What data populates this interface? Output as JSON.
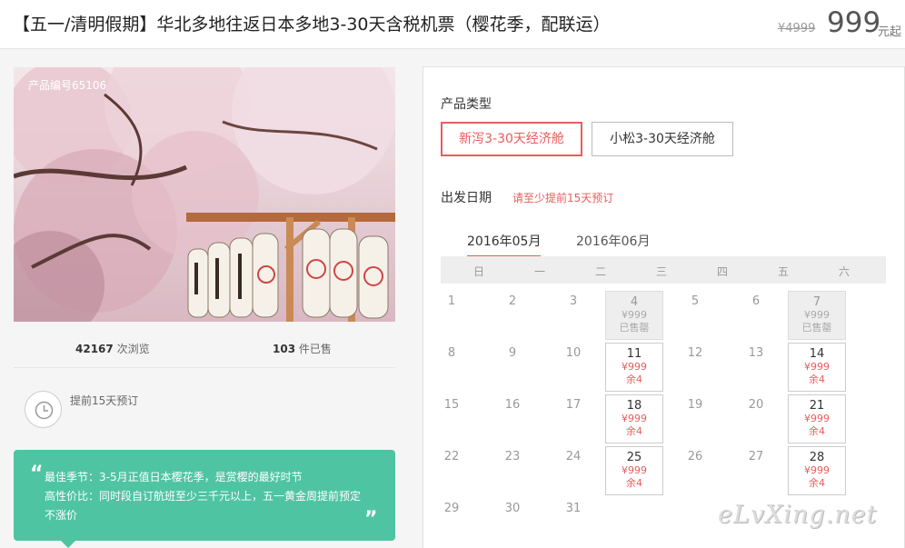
{
  "header": {
    "title": "【五一/清明假期】华北多地往返日本多地3-30天含税机票（樱花季，配联运）",
    "old_price": "¥4999",
    "price": "999",
    "price_unit": "元起"
  },
  "photo": {
    "product_code": "产品编号65106"
  },
  "stats": {
    "views_count": "42167",
    "views_label": "次浏览",
    "sold_count": "103",
    "sold_label": "件已售"
  },
  "advance": {
    "text": "提前15天预订",
    "icon": "clock-icon"
  },
  "tip": {
    "line1": "最佳季节：3-5月正值日本樱花季，是赏樱的最好时节",
    "line2": "高性价比：同时段自订航班至少三千元以上，五一黄金周提前预定",
    "line3": "不涨价",
    "open_quote": "“",
    "close_quote": "”"
  },
  "booking": {
    "type_label": "产品类型",
    "types": [
      "新泻3-30天经济舱",
      "小松3-30天经济舱"
    ],
    "selected_type": 0,
    "date_label": "出发日期",
    "date_hint": "请至少提前15天预订",
    "months": [
      "2016年05月",
      "2016年06月"
    ],
    "selected_month": 0,
    "weekdays": [
      "日",
      "一",
      "二",
      "三",
      "四",
      "五",
      "六"
    ]
  },
  "calendar": {
    "days": [
      {
        "n": "1"
      },
      {
        "n": "2"
      },
      {
        "n": "3"
      },
      {
        "n": "4",
        "price": "¥999",
        "status": "已售罄"
      },
      {
        "n": "5"
      },
      {
        "n": "6"
      },
      {
        "n": "7",
        "price": "¥999",
        "status": "已售罄"
      },
      {
        "n": "8"
      },
      {
        "n": "9"
      },
      {
        "n": "10"
      },
      {
        "n": "11",
        "price": "¥999",
        "status": "余4"
      },
      {
        "n": "12"
      },
      {
        "n": "13"
      },
      {
        "n": "14",
        "price": "¥999",
        "status": "余4"
      },
      {
        "n": "15"
      },
      {
        "n": "16"
      },
      {
        "n": "17"
      },
      {
        "n": "18",
        "price": "¥999",
        "status": "余4"
      },
      {
        "n": "19"
      },
      {
        "n": "20"
      },
      {
        "n": "21",
        "price": "¥999",
        "status": "余4"
      },
      {
        "n": "22"
      },
      {
        "n": "23"
      },
      {
        "n": "24"
      },
      {
        "n": "25",
        "price": "¥999",
        "status": "余4"
      },
      {
        "n": "26"
      },
      {
        "n": "27"
      },
      {
        "n": "28",
        "price": "¥999",
        "status": "余4"
      },
      {
        "n": "29"
      },
      {
        "n": "30"
      },
      {
        "n": "31"
      }
    ]
  },
  "watermark": "eLvXing.net",
  "colors": {
    "accent": "#e95c5c",
    "tip_bg": "#4fc4a2"
  }
}
